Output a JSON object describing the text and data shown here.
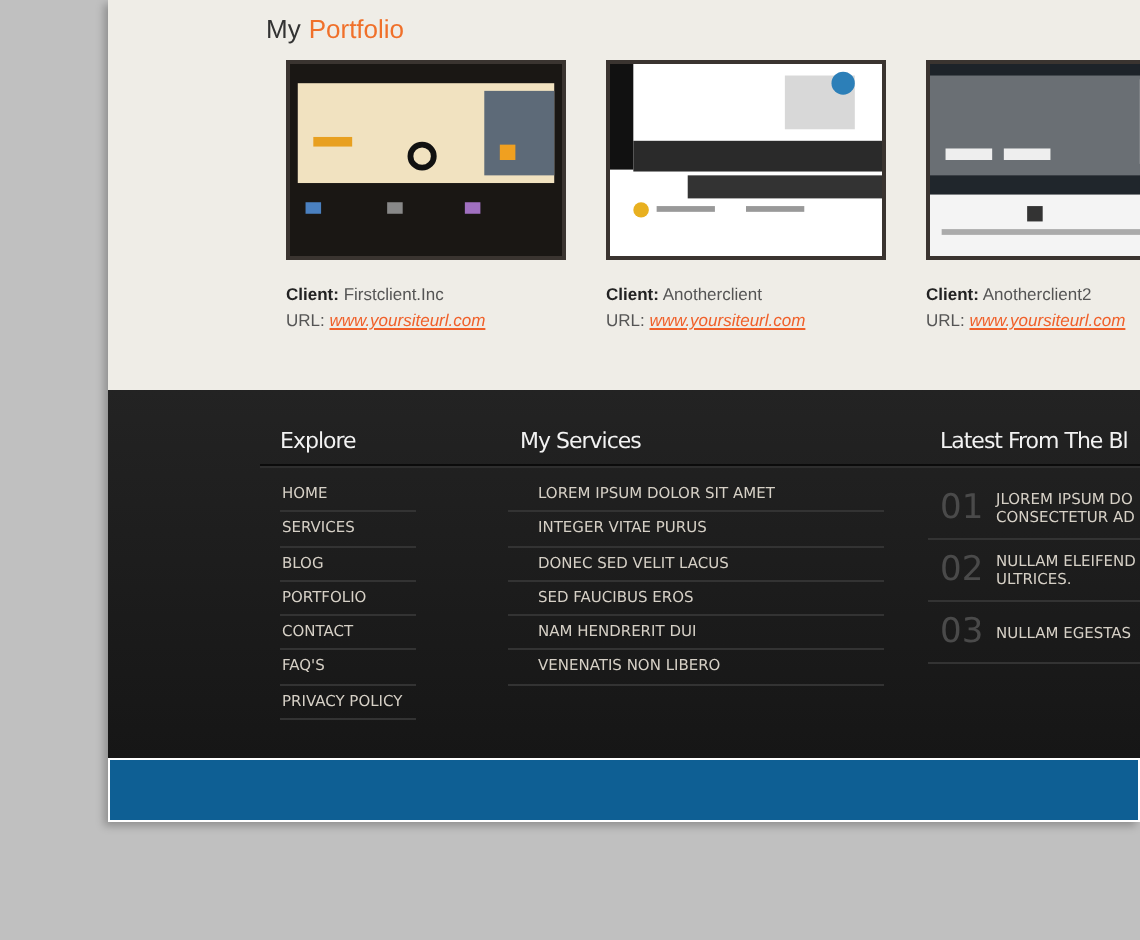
{
  "portfolio": {
    "heading": {
      "plain": "My",
      "accent": "Portfolio"
    },
    "items": [
      {
        "client_label": "Client:",
        "client": "Firstclient.Inc",
        "url_label": "URL:",
        "url": "www.yoursiteurl.com"
      },
      {
        "client_label": "Client:",
        "client": "Anotherclient",
        "url_label": "URL:",
        "url": "www.yoursiteurl.com"
      },
      {
        "client_label": "Client:",
        "client": "Anotherclient2",
        "url_label": "URL:",
        "url": "www.yoursiteurl.com"
      }
    ]
  },
  "footer": {
    "explore": {
      "title": "Explore",
      "links": [
        "HOME",
        "SERVICES",
        "BLOG",
        "PORTFOLIO",
        "CONTACT",
        "FAQ'S",
        "PRIVACY POLICY"
      ]
    },
    "services": {
      "title": "My Services",
      "links": [
        "LOREM IPSUM DOLOR SIT AMET",
        "INTEGER VITAE PURUS",
        "DONEC SED VELIT LACUS",
        "SED FAUCIBUS EROS",
        "NAM HENDRERIT DUI",
        "VENENATIS NON LIBERO"
      ]
    },
    "blog": {
      "title": "Latest From The Bl",
      "posts": [
        {
          "number": "01",
          "lines": [
            "JLOREM IPSUM DO",
            "CONSECTETUR AD"
          ]
        },
        {
          "number": "02",
          "lines": [
            "NULLAM ELEIFEND",
            "ULTRICES."
          ]
        },
        {
          "number": "03",
          "lines": [
            "NULLAM EGESTAS"
          ]
        }
      ]
    }
  }
}
